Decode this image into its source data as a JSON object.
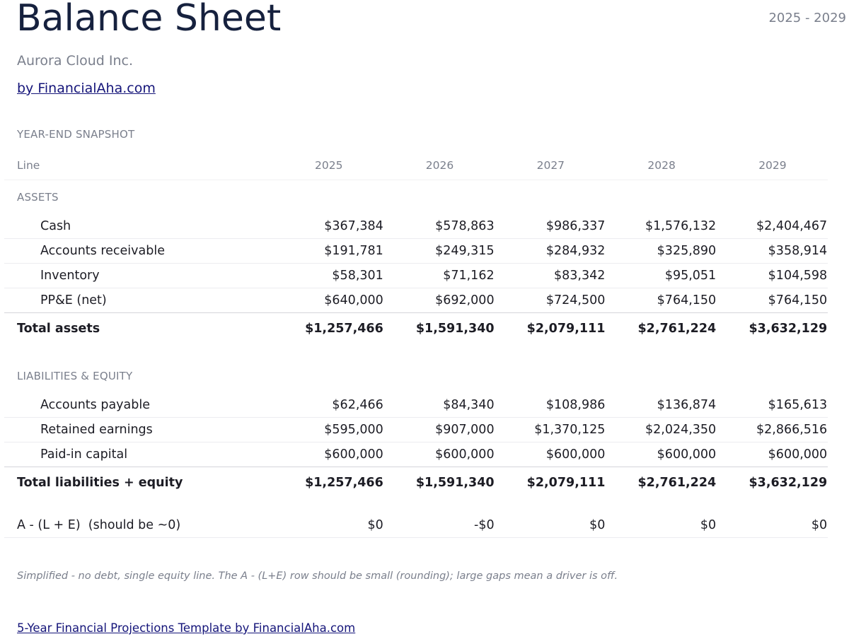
{
  "header": {
    "title": "Balance Sheet",
    "year_range": "2025 - 2029",
    "company": "Aurora Cloud Inc.",
    "byline": "by FinancialAha.com"
  },
  "snapshot": {
    "section_label": "YEAR-END SNAPSHOT",
    "columns": {
      "line": "Line",
      "years": [
        "2025",
        "2026",
        "2027",
        "2028",
        "2029"
      ]
    }
  },
  "assets": {
    "section_label": "ASSETS",
    "rows": [
      {
        "label": "Cash",
        "values": [
          "$367,384",
          "$578,863",
          "$986,337",
          "$1,576,132",
          "$2,404,467"
        ]
      },
      {
        "label": "Accounts receivable",
        "values": [
          "$191,781",
          "$249,315",
          "$284,932",
          "$325,890",
          "$358,914"
        ]
      },
      {
        "label": "Inventory",
        "values": [
          "$58,301",
          "$71,162",
          "$83,342",
          "$95,051",
          "$104,598"
        ]
      },
      {
        "label": "PP&E (net)",
        "values": [
          "$640,000",
          "$692,000",
          "$724,500",
          "$764,150",
          "$764,150"
        ]
      }
    ],
    "total": {
      "label": "Total assets",
      "values": [
        "$1,257,466",
        "$1,591,340",
        "$2,079,111",
        "$2,761,224",
        "$3,632,129"
      ]
    }
  },
  "liabilities_equity": {
    "section_label": "LIABILITIES & EQUITY",
    "rows": [
      {
        "label": "Accounts payable",
        "values": [
          "$62,466",
          "$84,340",
          "$108,986",
          "$136,874",
          "$165,613"
        ]
      },
      {
        "label": "Retained earnings",
        "values": [
          "$595,000",
          "$907,000",
          "$1,370,125",
          "$2,024,350",
          "$2,866,516"
        ]
      },
      {
        "label": "Paid-in capital",
        "values": [
          "$600,000",
          "$600,000",
          "$600,000",
          "$600,000",
          "$600,000"
        ]
      }
    ],
    "total": {
      "label": "Total liabilities + equity",
      "values": [
        "$1,257,466",
        "$1,591,340",
        "$2,079,111",
        "$2,761,224",
        "$3,632,129"
      ]
    }
  },
  "check": {
    "label": "A - (L + E)  (should be ~0)",
    "values": [
      "$0",
      "-$0",
      "$0",
      "$0",
      "$0"
    ]
  },
  "note": "Simplified - no debt, single equity line. The A - (L+E) row should be small (rounding); large gaps mean a driver is off.",
  "footer_link": "5-Year Financial Projections Template by FinancialAha.com"
}
